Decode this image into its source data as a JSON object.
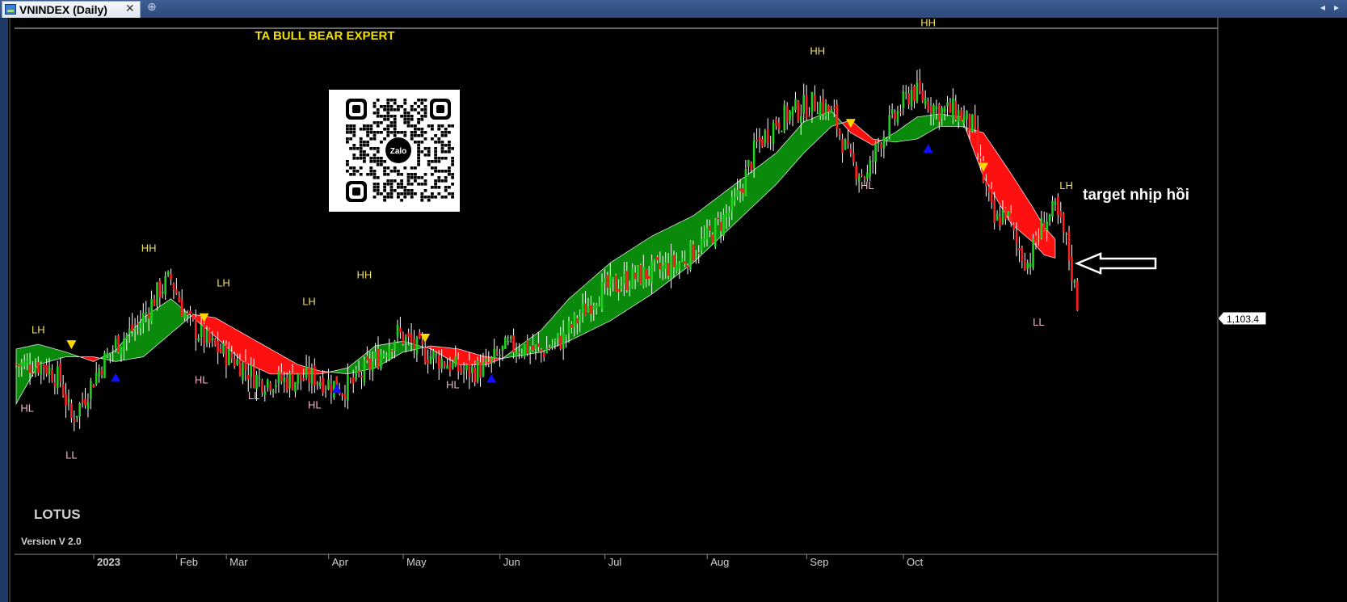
{
  "tab": {
    "title": "VNINDEX (Daily)",
    "close": "✕",
    "add": "⊕"
  },
  "nav": {
    "left": "◂",
    "right": "▸"
  },
  "texts": {
    "header": "TA BULL BEAR EXPERT",
    "brand": "LOTUS",
    "version": "Version V 2.0",
    "target": "target nhịp hồi",
    "price_label": "1,103.4",
    "qr_label": "Zalo"
  },
  "colors": {
    "bull": "#1fd11f",
    "bear": "#ff1f1f",
    "cloud_bull": "#0a8a0a",
    "cloud_bear": "#ff1010",
    "high_label": "#f0e06a",
    "low_label": "#f0b7c7",
    "buy_arrow": "#1010ff",
    "sell_arrow": "#ffd700"
  },
  "chart_data": {
    "type": "candlestick",
    "symbol": "VNINDEX",
    "interval": "Daily",
    "year": "2023",
    "months": [
      "2023",
      "Feb",
      "Mar",
      "Apr",
      "May",
      "Jun",
      "Jul",
      "Aug",
      "Sep",
      "Oct"
    ],
    "last_price": 1103.4,
    "ylim": [
      950,
      1280
    ],
    "keypoints": [
      {
        "x": 0,
        "close": 1070
      },
      {
        "x": 10,
        "close": 1070
      },
      {
        "x": 16,
        "close": 1060
      },
      {
        "x": 20,
        "close": 1035
      },
      {
        "x": 25,
        "close": 1050
      },
      {
        "x": 30,
        "close": 1068
      },
      {
        "x": 36,
        "close": 1083
      },
      {
        "x": 44,
        "close": 1095
      },
      {
        "x": 52,
        "close": 1118
      },
      {
        "x": 56,
        "close": 1125
      },
      {
        "x": 62,
        "close": 1098
      },
      {
        "x": 70,
        "close": 1083
      },
      {
        "x": 80,
        "close": 1072
      },
      {
        "x": 88,
        "close": 1060
      },
      {
        "x": 98,
        "close": 1060
      },
      {
        "x": 108,
        "close": 1062
      },
      {
        "x": 118,
        "close": 1055
      },
      {
        "x": 122,
        "close": 1058
      },
      {
        "x": 130,
        "close": 1073
      },
      {
        "x": 138,
        "close": 1090
      },
      {
        "x": 145,
        "close": 1080
      },
      {
        "x": 155,
        "close": 1072
      },
      {
        "x": 162,
        "close": 1065
      },
      {
        "x": 170,
        "close": 1068
      },
      {
        "x": 177,
        "close": 1080
      },
      {
        "x": 182,
        "close": 1082
      },
      {
        "x": 190,
        "close": 1078
      },
      {
        "x": 198,
        "close": 1087
      },
      {
        "x": 210,
        "close": 1115
      },
      {
        "x": 222,
        "close": 1125
      },
      {
        "x": 232,
        "close": 1130
      },
      {
        "x": 240,
        "close": 1135
      },
      {
        "x": 250,
        "close": 1150
      },
      {
        "x": 260,
        "close": 1172
      },
      {
        "x": 268,
        "close": 1210
      },
      {
        "x": 275,
        "close": 1225
      },
      {
        "x": 282,
        "close": 1232
      },
      {
        "x": 290,
        "close": 1238
      },
      {
        "x": 296,
        "close": 1228
      },
      {
        "x": 302,
        "close": 1198
      },
      {
        "x": 308,
        "close": 1190
      },
      {
        "x": 312,
        "close": 1212
      },
      {
        "x": 318,
        "close": 1228
      },
      {
        "x": 324,
        "close": 1245
      },
      {
        "x": 330,
        "close": 1238
      },
      {
        "x": 334,
        "close": 1232
      },
      {
        "x": 340,
        "close": 1232
      },
      {
        "x": 346,
        "close": 1222
      },
      {
        "x": 350,
        "close": 1188
      },
      {
        "x": 354,
        "close": 1160
      },
      {
        "x": 358,
        "close": 1168
      },
      {
        "x": 362,
        "close": 1146
      },
      {
        "x": 366,
        "close": 1135
      },
      {
        "x": 372,
        "close": 1162
      },
      {
        "x": 376,
        "close": 1168
      },
      {
        "x": 380,
        "close": 1148
      },
      {
        "x": 384,
        "close": 1110
      }
    ],
    "cloud": [
      [
        0,
        1045,
        1080
      ],
      [
        8,
        1070,
        1083
      ],
      [
        18,
        1075,
        1078
      ],
      [
        28,
        1075,
        1072
      ],
      [
        36,
        1072,
        1079
      ],
      [
        46,
        1075,
        1100
      ],
      [
        56,
        1090,
        1112
      ],
      [
        64,
        1102,
        1100
      ],
      [
        72,
        1100,
        1088
      ],
      [
        82,
        1090,
        1072
      ],
      [
        92,
        1080,
        1064
      ],
      [
        102,
        1070,
        1064
      ],
      [
        110,
        1066,
        1064
      ],
      [
        120,
        1064,
        1068
      ],
      [
        130,
        1068,
        1082
      ],
      [
        140,
        1078,
        1085
      ],
      [
        150,
        1082,
        1080
      ],
      [
        160,
        1080,
        1070
      ],
      [
        170,
        1075,
        1070
      ],
      [
        176,
        1074,
        1074
      ],
      [
        190,
        1078,
        1092
      ],
      [
        200,
        1085,
        1112
      ],
      [
        215,
        1098,
        1135
      ],
      [
        230,
        1115,
        1152
      ],
      [
        245,
        1135,
        1165
      ],
      [
        260,
        1160,
        1185
      ],
      [
        275,
        1185,
        1205
      ],
      [
        285,
        1205,
        1225
      ],
      [
        295,
        1222,
        1232
      ],
      [
        302,
        1226,
        1218
      ],
      [
        310,
        1214,
        1210
      ],
      [
        318,
        1212,
        1218
      ],
      [
        326,
        1214,
        1228
      ],
      [
        334,
        1222,
        1230
      ],
      [
        342,
        1222,
        1228
      ],
      [
        350,
        1218,
        1190
      ],
      [
        360,
        1192,
        1160
      ],
      [
        368,
        1170,
        1148
      ],
      [
        372,
        1158,
        1140
      ],
      [
        376,
        1150,
        1138
      ]
    ],
    "swing_labels": [
      {
        "x": 8,
        "text": "LH",
        "price": 1090,
        "type": "high"
      },
      {
        "x": 4,
        "text": "HL",
        "price": 1040,
        "type": "low"
      },
      {
        "x": 20,
        "text": "LL",
        "price": 1010,
        "type": "low"
      },
      {
        "x": 48,
        "text": "HH",
        "price": 1142,
        "type": "high"
      },
      {
        "x": 67,
        "text": "HL",
        "price": 1058,
        "type": "low"
      },
      {
        "x": 75,
        "text": "LH",
        "price": 1120,
        "type": "high"
      },
      {
        "x": 86,
        "text": "LL",
        "price": 1048,
        "type": "low"
      },
      {
        "x": 108,
        "text": "HL",
        "price": 1042,
        "type": "low"
      },
      {
        "x": 106,
        "text": "LH",
        "price": 1108,
        "type": "high"
      },
      {
        "x": 126,
        "text": "HH",
        "price": 1125,
        "type": "high"
      },
      {
        "x": 158,
        "text": "HL",
        "price": 1055,
        "type": "low"
      },
      {
        "x": 290,
        "text": "HH",
        "price": 1268,
        "type": "high"
      },
      {
        "x": 308,
        "text": "HL",
        "price": 1182,
        "type": "low"
      },
      {
        "x": 330,
        "text": "HH",
        "price": 1286,
        "type": "high"
      },
      {
        "x": 370,
        "text": "LL",
        "price": 1095,
        "type": "low"
      },
      {
        "x": 380,
        "text": "LH",
        "price": 1182,
        "type": "high"
      }
    ],
    "arrows": [
      {
        "x": 20,
        "type": "sell"
      },
      {
        "x": 36,
        "type": "buy"
      },
      {
        "x": 68,
        "type": "sell"
      },
      {
        "x": 116,
        "type": "buy"
      },
      {
        "x": 148,
        "type": "sell"
      },
      {
        "x": 172,
        "type": "buy"
      },
      {
        "x": 302,
        "type": "sell"
      },
      {
        "x": 330,
        "type": "buy"
      },
      {
        "x": 350,
        "type": "sell"
      }
    ]
  }
}
